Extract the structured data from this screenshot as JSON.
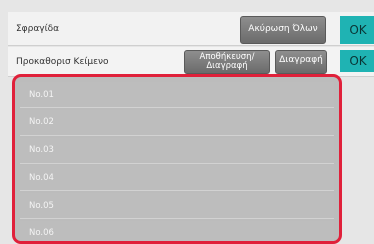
{
  "header": {
    "stamp_label": "Σφραγίδα",
    "cancel_all_label": "Ακύρωση Όλων",
    "ok_label": "OK"
  },
  "preset": {
    "label": "Προκαθορισ Κείμενο",
    "save_delete_label": "Αποθήκευση/ Διαγραφή",
    "delete_label": "Διαγραφή",
    "ok_label": "OK"
  },
  "list": {
    "items": [
      {
        "label": "No.01"
      },
      {
        "label": "No.02"
      },
      {
        "label": "No.03"
      },
      {
        "label": "No.04"
      },
      {
        "label": "No.05"
      },
      {
        "label": "No.06"
      }
    ]
  },
  "colors": {
    "accent_ok": "#1fb3b3",
    "highlight_border": "#e0203a"
  }
}
